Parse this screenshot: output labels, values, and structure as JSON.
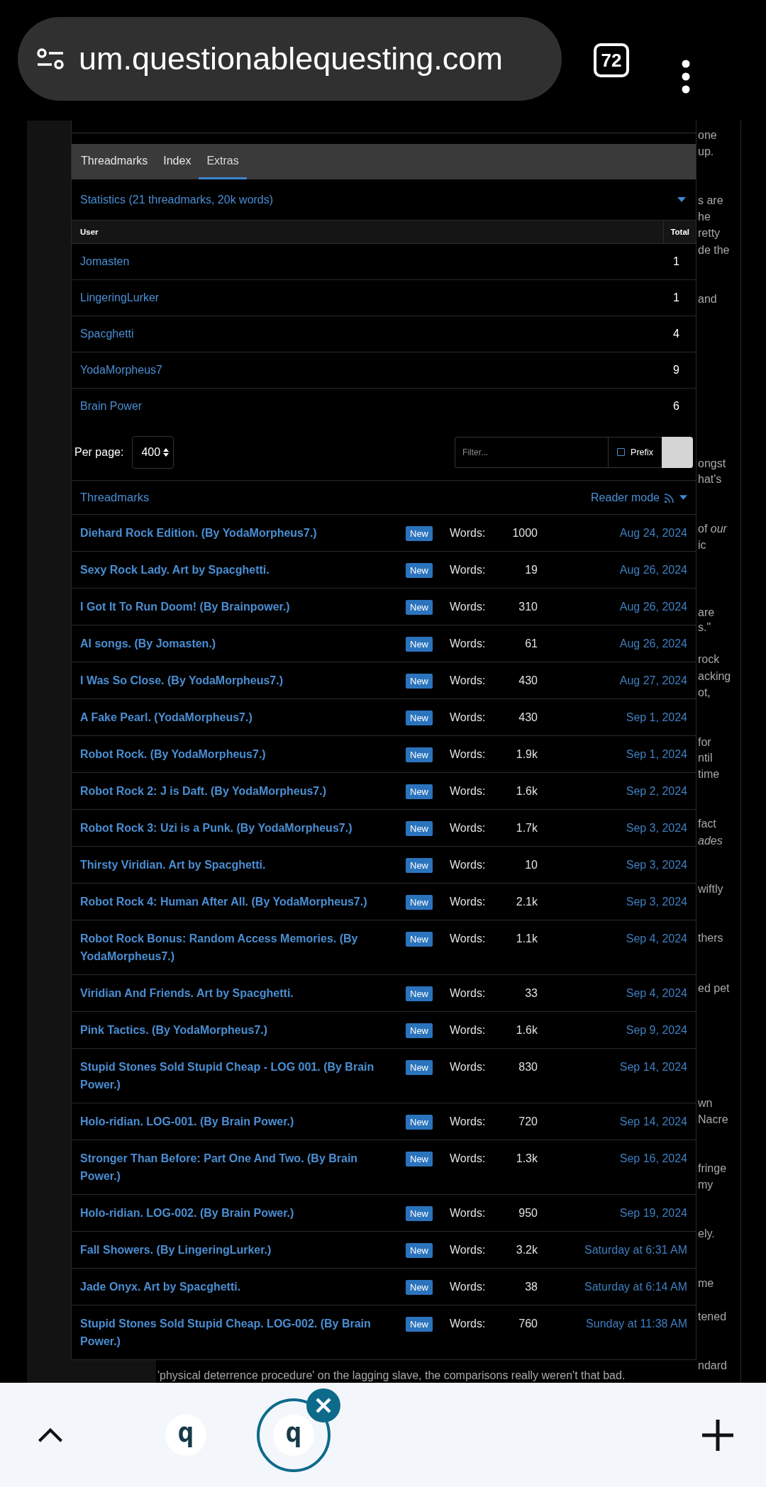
{
  "browser": {
    "url": "um.questionablequesting.com",
    "tab_count": "72"
  },
  "tabs": [
    {
      "label": "Threadmarks",
      "selected": false
    },
    {
      "label": "Index",
      "selected": false
    },
    {
      "label": "Extras",
      "selected": true
    }
  ],
  "statistics": {
    "title": "Statistics (21 threadmarks, 20k words)",
    "columns": [
      "User",
      "Total"
    ],
    "rows": [
      {
        "user": "Jomasten",
        "total": "1"
      },
      {
        "user": "LingeringLurker",
        "total": "1"
      },
      {
        "user": "Spacghetti",
        "total": "4"
      },
      {
        "user": "YodaMorpheus7",
        "total": "9"
      },
      {
        "user": "Brain Power",
        "total": "6"
      }
    ]
  },
  "pagination": {
    "label": "Per page:",
    "value": "400"
  },
  "filter": {
    "placeholder": "Filter...",
    "prefix_label": "Prefix",
    "prefix_checked": false
  },
  "threadmarks": {
    "title": "Threadmarks",
    "reader_mode": "Reader mode",
    "rows": [
      {
        "title": "Diehard Rock Edition. (By YodaMorpheus7.)",
        "badge": "New",
        "words_label": "Words:",
        "words": "1000",
        "date": "Aug 24, 2024"
      },
      {
        "title": "Sexy Rock Lady. Art by Spacghetti.",
        "badge": "New",
        "words_label": "Words:",
        "words": "19",
        "date": "Aug 26, 2024"
      },
      {
        "title": "I Got It To Run Doom! (By Brainpower.)",
        "badge": "New",
        "words_label": "Words:",
        "words": "310",
        "date": "Aug 26, 2024"
      },
      {
        "title": "AI songs. (By Jomasten.)",
        "badge": "New",
        "words_label": "Words:",
        "words": "61",
        "date": "Aug 26, 2024"
      },
      {
        "title": "I Was So Close. (By YodaMorpheus7.)",
        "badge": "New",
        "words_label": "Words:",
        "words": "430",
        "date": "Aug 27, 2024"
      },
      {
        "title": "A Fake Pearl. (YodaMorpheus7.)",
        "badge": "New",
        "words_label": "Words:",
        "words": "430",
        "date": "Sep 1, 2024"
      },
      {
        "title": "Robot Rock. (By YodaMorpheus7.)",
        "badge": "New",
        "words_label": "Words:",
        "words": "1.9k",
        "date": "Sep 1, 2024"
      },
      {
        "title": "Robot Rock 2: J is Daft. (By YodaMorpheus7.)",
        "badge": "New",
        "words_label": "Words:",
        "words": "1.6k",
        "date": "Sep 2, 2024"
      },
      {
        "title": "Robot Rock 3: Uzi is a Punk. (By YodaMorpheus7.)",
        "badge": "New",
        "words_label": "Words:",
        "words": "1.7k",
        "date": "Sep 3, 2024"
      },
      {
        "title": "Thirsty Viridian. Art by Spacghetti.",
        "badge": "New",
        "words_label": "Words:",
        "words": "10",
        "date": "Sep 3, 2024"
      },
      {
        "title": "Robot Rock 4: Human After All. (By YodaMorpheus7.)",
        "badge": "New",
        "words_label": "Words:",
        "words": "2.1k",
        "date": "Sep 3, 2024"
      },
      {
        "title": "Robot Rock Bonus: Random Access Memories. (By YodaMorpheus7.)",
        "badge": "New",
        "words_label": "Words:",
        "words": "1.1k",
        "date": "Sep 4, 2024"
      },
      {
        "title": "Viridian And Friends. Art by Spacghetti.",
        "badge": "New",
        "words_label": "Words:",
        "words": "33",
        "date": "Sep 4, 2024"
      },
      {
        "title": "Pink Tactics. (By YodaMorpheus7.)",
        "badge": "New",
        "words_label": "Words:",
        "words": "1.6k",
        "date": "Sep 9, 2024"
      },
      {
        "title": "Stupid Stones Sold Stupid Cheap - LOG 001. (By Brain Power.)",
        "badge": "New",
        "words_label": "Words:",
        "words": "830",
        "date": "Sep 14, 2024"
      },
      {
        "title": "Holo-ridian. LOG-001. (By Brain Power.)",
        "badge": "New",
        "words_label": "Words:",
        "words": "720",
        "date": "Sep 14, 2024"
      },
      {
        "title": "Stronger Than Before: Part One And Two. (By Brain Power.)",
        "badge": "New",
        "words_label": "Words:",
        "words": "1.3k",
        "date": "Sep 16, 2024"
      },
      {
        "title": "Holo-ridian. LOG-002. (By Brain Power.)",
        "badge": "New",
        "words_label": "Words:",
        "words": "950",
        "date": "Sep 19, 2024"
      },
      {
        "title": "Fall Showers. (By LingeringLurker.)",
        "badge": "New",
        "words_label": "Words:",
        "words": "3.2k",
        "date": "Saturday at 6:31 AM"
      },
      {
        "title": "Jade Onyx. Art by Spacghetti.",
        "badge": "New",
        "words_label": "Words:",
        "words": "38",
        "date": "Saturday at 6:14 AM"
      },
      {
        "title": "Stupid Stones Sold Stupid Cheap. LOG-002. (By Brain Power.)",
        "badge": "New",
        "words_label": "Words:",
        "words": "760",
        "date": "Sunday at 11:38 AM"
      }
    ]
  },
  "background_text": [
    "one",
    "up.",
    "s are",
    "he",
    "retty",
    "de the",
    "and",
    "ongst",
    "hat's",
    "of *our*",
    "ic",
    "are",
    "s.\"",
    "rock",
    "acking",
    "ot,",
    "for",
    "ntil",
    "time",
    "fact",
    "*ades*",
    "wiftly",
    "thers",
    "ed pet",
    "wn",
    "Nacre",
    "fringe",
    "my",
    "ely.",
    "me",
    "tened",
    "ndard"
  ],
  "background_line": "'physical deterrence procedure' on the lagging slave, the comparisons really weren't that bad.",
  "bottom_bar": {
    "tabs": [
      {
        "letter": "q",
        "selected": false
      },
      {
        "letter": "q",
        "selected": true
      }
    ]
  }
}
